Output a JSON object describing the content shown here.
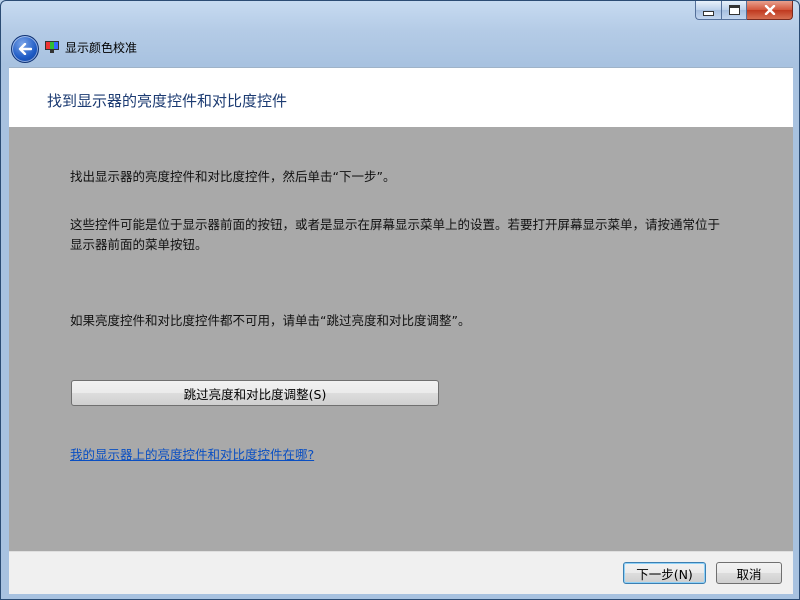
{
  "window": {
    "title": "显示颜色校准"
  },
  "header": {
    "heading": "找到显示器的亮度控件和对比度控件"
  },
  "content": {
    "instruction_1": "找出显示器的亮度控件和对比度控件，然后单击“下一步”。",
    "instruction_2": "这些控件可能是位于显示器前面的按钮，或者是显示在屏幕显示菜单上的设置。若要打开屏幕显示菜单，请按通常位于显示器前面的菜单按钮。",
    "instruction_3": "如果亮度控件和对比度控件都不可用，请单击“跳过亮度和对比度调整”。",
    "skip_button": "跳过亮度和对比度调整(S)",
    "help_link": "我的显示器上的亮度控件和对比度控件在哪?"
  },
  "footer": {
    "next_button": "下一步(N)",
    "cancel_button": "取消"
  },
  "icons": {
    "back": "back-arrow-icon",
    "app": "monitor-color-icon",
    "minimize": "minimize-icon",
    "maximize": "maximize-icon",
    "close": "close-icon"
  },
  "colors": {
    "header_text": "#1c3b72",
    "link": "#0a4fc2",
    "content_bg": "#a9a9a9",
    "close_button": "#c0391f"
  }
}
